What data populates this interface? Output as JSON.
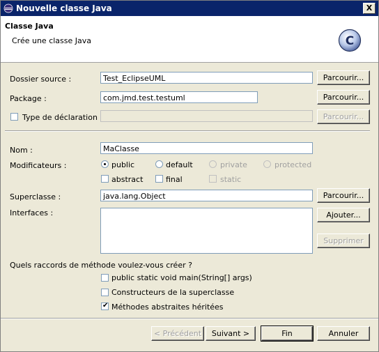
{
  "window": {
    "title": "Nouvelle classe Java",
    "close_label": "X"
  },
  "header": {
    "title": "Classe Java",
    "subtitle": "Crée une classe Java",
    "icon_letter": "C"
  },
  "form": {
    "source_folder": {
      "label": "Dossier source :",
      "value": "Test_EclipseUML",
      "browse": "Parcourir..."
    },
    "package": {
      "label": "Package :",
      "value": "com.jmd.test.testuml",
      "browse": "Parcourir..."
    },
    "enclosing_type": {
      "label": "Type de déclaration :",
      "value": "",
      "browse": "Parcourir...",
      "checked": false
    },
    "name": {
      "label": "Nom :",
      "value": "MaClasse"
    },
    "modifiers": {
      "label": "Modificateurs :",
      "public": "public",
      "default": "default",
      "private": "private",
      "protected": "protected",
      "abstract": "abstract",
      "final": "final",
      "static": "static",
      "selected": "public"
    },
    "superclass": {
      "label": "Superclasse :",
      "value": "java.lang.Object",
      "browse": "Parcourir..."
    },
    "interfaces": {
      "label": "Interfaces :",
      "add": "Ajouter...",
      "remove": "Supprimer"
    },
    "stubs": {
      "question": "Quels raccords de méthode voulez-vous créer ?",
      "main": "public static void main(String[] args)",
      "constructors": "Constructeurs de la superclasse",
      "inherited": "Méthodes abstraites héritées",
      "main_checked": false,
      "constructors_checked": false,
      "inherited_checked": true
    }
  },
  "footer": {
    "back": "< Précédent",
    "next": "Suivant >",
    "finish": "Fin",
    "cancel": "Annuler"
  }
}
